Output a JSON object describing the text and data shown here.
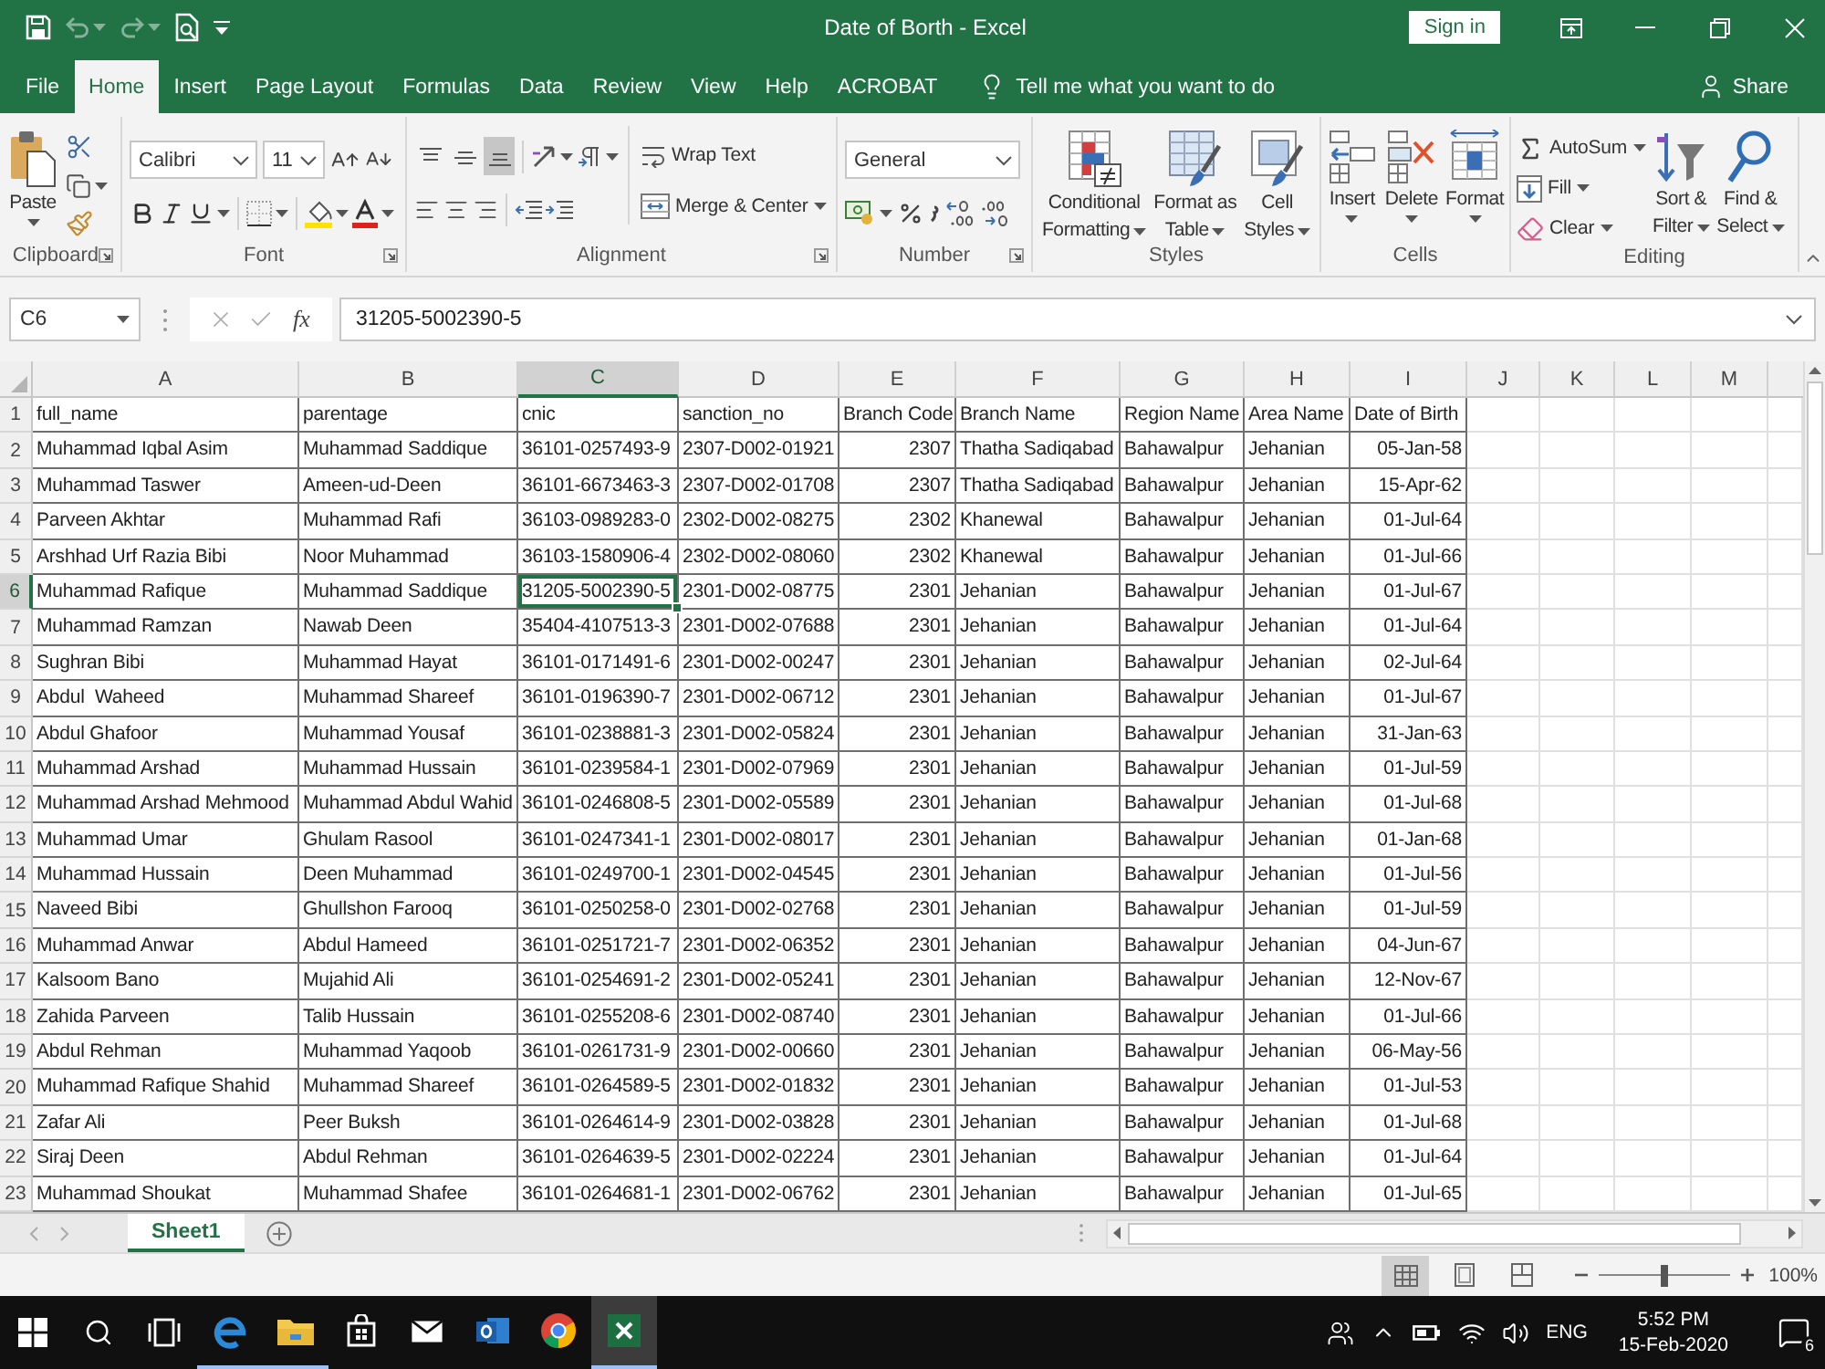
{
  "quick_access": [
    {
      "kind": "save",
      "disabled": false
    },
    {
      "kind": "undo",
      "disabled": true
    },
    {
      "kind": "redo",
      "disabled": true
    },
    {
      "kind": "preview",
      "disabled": false
    },
    {
      "kind": "customize",
      "disabled": false
    }
  ],
  "window": {
    "title": "Date of Borth - Excel",
    "sign_in": "Sign in"
  },
  "tabs": [
    {
      "label": "File",
      "selected": false
    },
    {
      "label": "Home",
      "selected": true
    },
    {
      "label": "Insert",
      "selected": false
    },
    {
      "label": "Page Layout",
      "selected": false
    },
    {
      "label": "Formulas",
      "selected": false
    },
    {
      "label": "Data",
      "selected": false
    },
    {
      "label": "Review",
      "selected": false
    },
    {
      "label": "View",
      "selected": false
    },
    {
      "label": "Help",
      "selected": false
    },
    {
      "label": "ACROBAT",
      "selected": false
    }
  ],
  "tell_me": "Tell me what you want to do",
  "share": "Share",
  "ribbon": {
    "clipboard": {
      "label": "Clipboard",
      "paste": "Paste"
    },
    "font": {
      "label": "Font",
      "font_name": "Calibri",
      "font_size": "11"
    },
    "alignment": {
      "label": "Alignment",
      "vertical": [
        {
          "kind": "top",
          "selected": false
        },
        {
          "kind": "middle",
          "selected": false
        },
        {
          "kind": "bottom",
          "selected": true
        }
      ],
      "wrap_text": "Wrap Text",
      "merge": "Merge & Center"
    },
    "number": {
      "label": "Number",
      "format": "General"
    },
    "styles": {
      "label": "Styles",
      "buttons": [
        {
          "kind": "conditional",
          "label": [
            "Conditional",
            "Formatting"
          ]
        },
        {
          "kind": "table",
          "label": [
            "Format as",
            "Table"
          ]
        },
        {
          "kind": "cell_styles",
          "label": [
            "Cell",
            "Styles"
          ]
        }
      ]
    },
    "cells": {
      "label": "Cells",
      "buttons": [
        {
          "kind": "insert",
          "label": [
            "Insert"
          ]
        },
        {
          "kind": "delete",
          "label": [
            "Delete"
          ]
        },
        {
          "kind": "format",
          "label": [
            "Format"
          ]
        }
      ]
    },
    "editing": {
      "label": "Editing",
      "small": [
        {
          "kind": "sum",
          "label": "AutoSum"
        },
        {
          "kind": "fill",
          "label": "Fill"
        },
        {
          "kind": "clear",
          "label": "Clear"
        }
      ],
      "big": [
        {
          "kind": "sort",
          "label": [
            "Sort &",
            "Filter"
          ]
        },
        {
          "kind": "find",
          "label": [
            "Find &",
            "Select"
          ]
        }
      ]
    }
  },
  "formula_bar": {
    "name_box": "C6",
    "function_label": "fx",
    "formula": "31205-5002390-5"
  },
  "sheet": {
    "columns": [
      {
        "label": "A",
        "selected": false,
        "kind": "text"
      },
      {
        "label": "B",
        "selected": false,
        "kind": "text"
      },
      {
        "label": "C",
        "selected": true,
        "kind": "text"
      },
      {
        "label": "D",
        "selected": false,
        "kind": "text"
      },
      {
        "label": "E",
        "selected": false,
        "kind": "number"
      },
      {
        "label": "F",
        "selected": false,
        "kind": "text"
      },
      {
        "label": "G",
        "selected": false,
        "kind": "text"
      },
      {
        "label": "H",
        "selected": false,
        "kind": "text"
      },
      {
        "label": "I",
        "selected": false,
        "kind": "date"
      },
      {
        "label": "J",
        "selected": false
      },
      {
        "label": "K",
        "selected": false
      },
      {
        "label": "L",
        "selected": false
      },
      {
        "label": "M",
        "selected": false
      }
    ],
    "rows": [
      {
        "number": "1",
        "selected": false,
        "kind": "header",
        "cells": [
          "full_name",
          "parentage",
          "cnic",
          "sanction_no",
          "Branch Code",
          "Branch Name",
          "Region Name",
          "Area Name",
          "Date of Birth"
        ]
      },
      {
        "number": "2",
        "selected": false,
        "kind": "data",
        "cells": [
          "Muhammad Iqbal Asim",
          "Muhammad Saddique",
          "36101-0257493-9",
          "2307-D002-01921",
          "2307",
          "Thatha Sadiqabad",
          "Bahawalpur",
          "Jehanian",
          "05-Jan-58"
        ]
      },
      {
        "number": "3",
        "selected": false,
        "kind": "data",
        "cells": [
          "Muhammad Taswer",
          "Ameen-ud-Deen",
          "36101-6673463-3",
          "2307-D002-01708",
          "2307",
          "Thatha Sadiqabad",
          "Bahawalpur",
          "Jehanian",
          "15-Apr-62"
        ]
      },
      {
        "number": "4",
        "selected": false,
        "kind": "data",
        "cells": [
          "Parveen Akhtar",
          "Muhammad Rafi",
          "36103-0989283-0",
          "2302-D002-08275",
          "2302",
          "Khanewal",
          "Bahawalpur",
          "Jehanian",
          "01-Jul-64"
        ]
      },
      {
        "number": "5",
        "selected": false,
        "kind": "data",
        "cells": [
          "Arshhad Urf Razia Bibi",
          "Noor Muhammad",
          "36103-1580906-4",
          "2302-D002-08060",
          "2302",
          "Khanewal",
          "Bahawalpur",
          "Jehanian",
          "01-Jul-66"
        ]
      },
      {
        "number": "6",
        "selected": true,
        "kind": "data",
        "cells": [
          "Muhammad Rafique",
          "Muhammad Saddique",
          "31205-5002390-5",
          "2301-D002-08775",
          "2301",
          "Jehanian",
          "Bahawalpur",
          "Jehanian",
          "01-Jul-67"
        ]
      },
      {
        "number": "7",
        "selected": false,
        "kind": "data",
        "cells": [
          "Muhammad Ramzan",
          "Nawab Deen",
          "35404-4107513-3",
          "2301-D002-07688",
          "2301",
          "Jehanian",
          "Bahawalpur",
          "Jehanian",
          "01-Jul-64"
        ]
      },
      {
        "number": "8",
        "selected": false,
        "kind": "data",
        "cells": [
          "Sughran Bibi",
          "Muhammad Hayat",
          "36101-0171491-6",
          "2301-D002-00247",
          "2301",
          "Jehanian",
          "Bahawalpur",
          "Jehanian",
          "02-Jul-64"
        ]
      },
      {
        "number": "9",
        "selected": false,
        "kind": "data",
        "cells": [
          "Abdul  Waheed",
          "Muhammad Shareef",
          "36101-0196390-7",
          "2301-D002-06712",
          "2301",
          "Jehanian",
          "Bahawalpur",
          "Jehanian",
          "01-Jul-67"
        ]
      },
      {
        "number": "10",
        "selected": false,
        "kind": "data",
        "cells": [
          "Abdul Ghafoor",
          "Muhammad Yousaf",
          "36101-0238881-3",
          "2301-D002-05824",
          "2301",
          "Jehanian",
          "Bahawalpur",
          "Jehanian",
          "31-Jan-63"
        ]
      },
      {
        "number": "11",
        "selected": false,
        "kind": "data",
        "cells": [
          "Muhammad Arshad",
          "Muhammad Hussain",
          "36101-0239584-1",
          "2301-D002-07969",
          "2301",
          "Jehanian",
          "Bahawalpur",
          "Jehanian",
          "01-Jul-59"
        ]
      },
      {
        "number": "12",
        "selected": false,
        "kind": "data",
        "cells": [
          "Muhammad Arshad Mehmood",
          "Muhammad Abdul Wahid",
          "36101-0246808-5",
          "2301-D002-05589",
          "2301",
          "Jehanian",
          "Bahawalpur",
          "Jehanian",
          "01-Jul-68"
        ]
      },
      {
        "number": "13",
        "selected": false,
        "kind": "data",
        "cells": [
          "Muhammad Umar",
          "Ghulam Rasool",
          "36101-0247341-1",
          "2301-D002-08017",
          "2301",
          "Jehanian",
          "Bahawalpur",
          "Jehanian",
          "01-Jan-68"
        ]
      },
      {
        "number": "14",
        "selected": false,
        "kind": "data",
        "cells": [
          "Muhammad Hussain",
          "Deen Muhammad",
          "36101-0249700-1",
          "2301-D002-04545",
          "2301",
          "Jehanian",
          "Bahawalpur",
          "Jehanian",
          "01-Jul-56"
        ]
      },
      {
        "number": "15",
        "selected": false,
        "kind": "data",
        "cells": [
          "Naveed Bibi",
          "Ghullshon Farooq",
          "36101-0250258-0",
          "2301-D002-02768",
          "2301",
          "Jehanian",
          "Bahawalpur",
          "Jehanian",
          "01-Jul-59"
        ]
      },
      {
        "number": "16",
        "selected": false,
        "kind": "data",
        "cells": [
          "Muhammad Anwar",
          "Abdul Hameed",
          "36101-0251721-7",
          "2301-D002-06352",
          "2301",
          "Jehanian",
          "Bahawalpur",
          "Jehanian",
          "04-Jun-67"
        ]
      },
      {
        "number": "17",
        "selected": false,
        "kind": "data",
        "cells": [
          "Kalsoom Bano",
          "Mujahid Ali",
          "36101-0254691-2",
          "2301-D002-05241",
          "2301",
          "Jehanian",
          "Bahawalpur",
          "Jehanian",
          "12-Nov-67"
        ]
      },
      {
        "number": "18",
        "selected": false,
        "kind": "data",
        "cells": [
          "Zahida Parveen",
          "Talib Hussain",
          "36101-0255208-6",
          "2301-D002-08740",
          "2301",
          "Jehanian",
          "Bahawalpur",
          "Jehanian",
          "01-Jul-66"
        ]
      },
      {
        "number": "19",
        "selected": false,
        "kind": "data",
        "cells": [
          "Abdul Rehman",
          "Muhammad Yaqoob",
          "36101-0261731-9",
          "2301-D002-00660",
          "2301",
          "Jehanian",
          "Bahawalpur",
          "Jehanian",
          "06-May-56"
        ]
      },
      {
        "number": "20",
        "selected": false,
        "kind": "data",
        "cells": [
          "Muhammad Rafique Shahid",
          "Muhammad Shareef",
          "36101-0264589-5",
          "2301-D002-01832",
          "2301",
          "Jehanian",
          "Bahawalpur",
          "Jehanian",
          "01-Jul-53"
        ]
      },
      {
        "number": "21",
        "selected": false,
        "kind": "data",
        "cells": [
          "Zafar Ali",
          "Peer Buksh",
          "36101-0264614-9",
          "2301-D002-03828",
          "2301",
          "Jehanian",
          "Bahawalpur",
          "Jehanian",
          "01-Jul-68"
        ]
      },
      {
        "number": "22",
        "selected": false,
        "kind": "data",
        "cells": [
          "Siraj Deen",
          "Abdul Rehman",
          "36101-0264639-5",
          "2301-D002-02224",
          "2301",
          "Jehanian",
          "Bahawalpur",
          "Jehanian",
          "01-Jul-64"
        ]
      },
      {
        "number": "23",
        "selected": false,
        "kind": "data",
        "cells": [
          "Muhammad Shoukat",
          "Muhammad Shafee",
          "36101-0264681-1",
          "2301-D002-06762",
          "2301",
          "Jehanian",
          "Bahawalpur",
          "Jehanian",
          "01-Jul-65"
        ]
      }
    ]
  },
  "sheet_tabs": [
    {
      "label": "Sheet1",
      "selected": true
    }
  ],
  "status_bar": {
    "views": [
      {
        "kind": "normal",
        "selected": true
      },
      {
        "kind": "page_layout",
        "selected": false
      },
      {
        "kind": "page_break",
        "selected": false
      }
    ],
    "zoom": {
      "level": 0.5,
      "reading": "100%"
    }
  },
  "taskbar": {
    "apps": [
      {
        "kind": "edge",
        "running": true,
        "active": false
      },
      {
        "kind": "explorer",
        "running": true,
        "active": false
      },
      {
        "kind": "store",
        "running": false,
        "active": false
      },
      {
        "kind": "mail",
        "running": false,
        "active": false
      },
      {
        "kind": "outlook",
        "running": false,
        "active": false
      },
      {
        "kind": "chrome",
        "running": false,
        "active": false
      },
      {
        "kind": "excel",
        "running": true,
        "active": true
      }
    ],
    "tray": {
      "language": "ENG",
      "time": "5:52 PM",
      "date": "15-Feb-2020",
      "notifications": "6"
    }
  }
}
